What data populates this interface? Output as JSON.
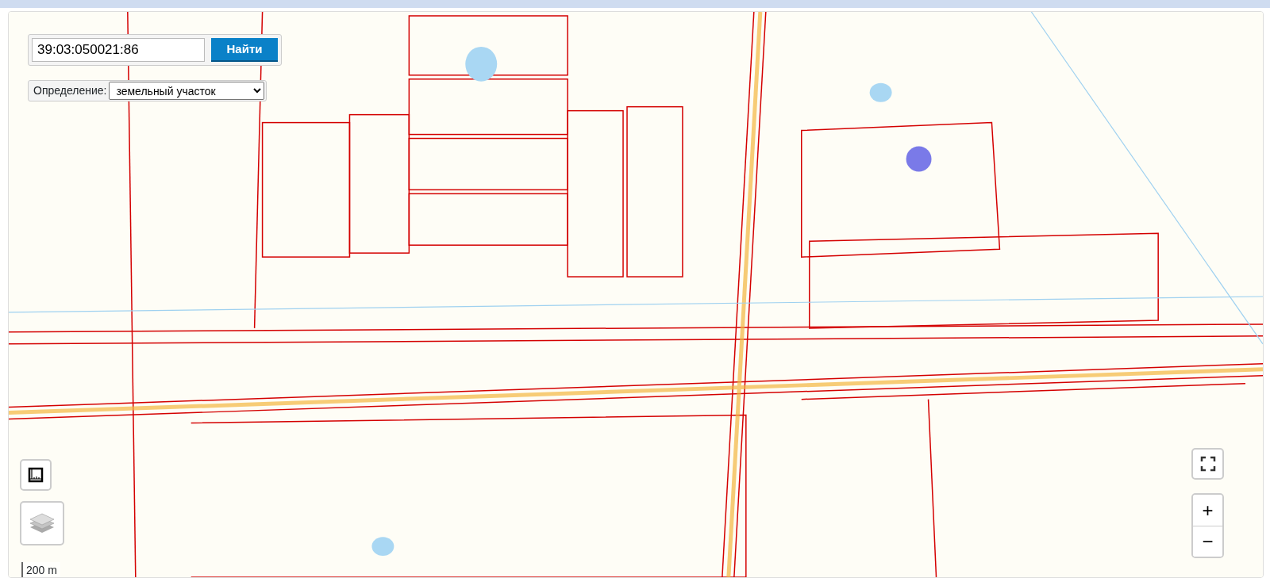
{
  "search": {
    "value": "39:03:050021:86",
    "button": "Найти"
  },
  "definition": {
    "label": "Определение:",
    "value": "земельный участок"
  },
  "zoom": {
    "plus": "+",
    "minus": "−"
  },
  "scale": "200 m"
}
